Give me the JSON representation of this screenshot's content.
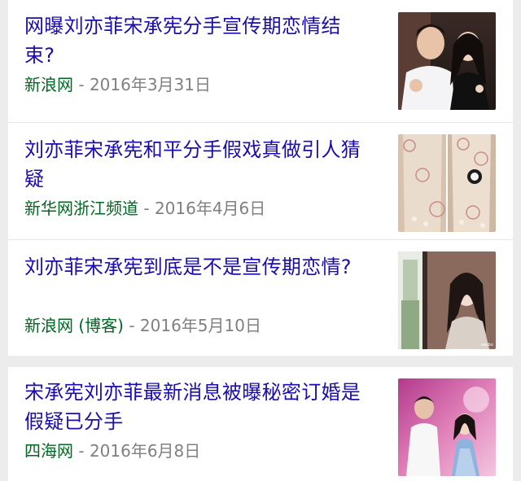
{
  "results": [
    {
      "title": "网曝刘亦菲宋承宪分手宣传期恋情结束?",
      "source": "新浪网",
      "separator": " - ",
      "date": "2016年3月31日",
      "image_icon": "couple-selfie-photo"
    },
    {
      "title": "刘亦菲宋承宪和平分手假戏真做引人猜疑",
      "source": "新华网浙江频道",
      "separator": " - ",
      "date": "2016年4月6日",
      "image_icon": "dress-closeup-photo"
    },
    {
      "title": "刘亦菲宋承宪到底是不是宣传期恋情?",
      "source": "新浪网 (博客)",
      "separator": " - ",
      "date": "2016年5月10日",
      "image_icon": "window-portrait-photo"
    },
    {
      "title": "宋承宪刘亦菲最新消息被曝秘密订婚是假疑已分手",
      "source": "四海网",
      "separator": " - ",
      "date": "2016年6月8日",
      "image_icon": "stage-event-photo"
    }
  ],
  "colors": {
    "title": "#1a0dab",
    "source": "#006621",
    "date": "#808080",
    "background": "#ececec"
  }
}
